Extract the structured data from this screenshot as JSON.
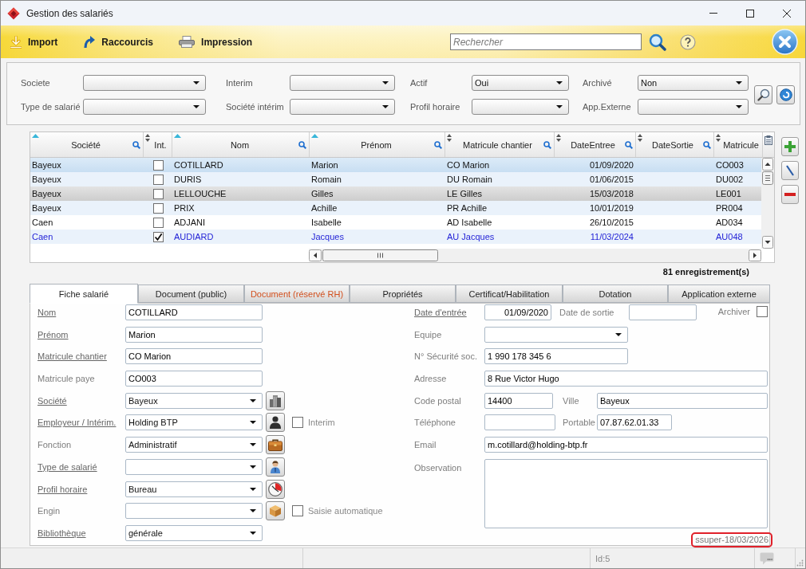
{
  "window": {
    "title": "Gestion des salariés"
  },
  "toolbar": {
    "buttons": [
      {
        "label": "Import"
      },
      {
        "label": "Raccourcis"
      },
      {
        "label": "Impression"
      }
    ],
    "search": {
      "placeholder": "Rechercher"
    }
  },
  "filters": [
    {
      "label": "Societe"
    },
    {
      "label": "Interim"
    },
    {
      "label": "Actif",
      "value": "Oui"
    },
    {
      "label": "Archivé",
      "value": "Non"
    },
    {
      "label": "Type de salarié"
    },
    {
      "label": "Société intérim"
    },
    {
      "label": "Profil horaire"
    },
    {
      "label": "App.Externe"
    }
  ],
  "table": {
    "columns": [
      {
        "label": "Société",
        "sorted": true,
        "searchable": true
      },
      {
        "label": "Int.",
        "sorted": false,
        "searchable": false
      },
      {
        "label": "Nom",
        "sorted": true,
        "searchable": true
      },
      {
        "label": "Prénom",
        "sorted": true,
        "searchable": true
      },
      {
        "label": "Matricule chantier",
        "sorted": false,
        "searchable": true
      },
      {
        "label": "DateEntree",
        "sorted": false,
        "searchable": true
      },
      {
        "label": "DateSortie",
        "sorted": false,
        "searchable": true
      },
      {
        "label": "Matricule",
        "sorted": false
      }
    ],
    "rows": [
      {
        "societe": "Bayeux",
        "interim": false,
        "nom": "COTILLARD",
        "prenom": "Marion",
        "matricule_chantier": "CO Marion",
        "date_entree": "01/09/2020",
        "matricule": "CO003",
        "selected": true,
        "hovered": false
      },
      {
        "societe": "Bayeux",
        "interim": false,
        "nom": "DURIS",
        "prenom": "Romain",
        "matricule_chantier": "DU Romain",
        "date_entree": "01/06/2015",
        "matricule": "DU002",
        "selected": false,
        "hovered": false
      },
      {
        "societe": "Bayeux",
        "interim": false,
        "nom": "LELLOUCHE",
        "prenom": "Gilles",
        "matricule_chantier": "LE Gilles",
        "date_entree": "15/03/2018",
        "matricule": "LE001",
        "selected": false,
        "hovered": true
      },
      {
        "societe": "Bayeux",
        "interim": false,
        "nom": "PRIX",
        "prenom": "Achille",
        "matricule_chantier": "PR Achille",
        "date_entree": "10/01/2019",
        "matricule": "PR004",
        "selected": false,
        "hovered": false
      },
      {
        "societe": "Caen",
        "interim": false,
        "nom": "ADJANI",
        "prenom": "Isabelle",
        "matricule_chantier": "AD Isabelle",
        "date_entree": "26/10/2015",
        "matricule": "AD034",
        "selected": false,
        "hovered": false
      },
      {
        "societe": "Caen",
        "interim": true,
        "nom": "AUDIARD",
        "prenom": "Jacques",
        "matricule_chantier": "AU Jacques",
        "date_entree": "11/03/2024",
        "matricule": "AU048",
        "selected": false,
        "hovered": false
      }
    ],
    "record_count": "81 enregistrement(s)"
  },
  "tabs": [
    {
      "label": "Fiche salarié",
      "selected": true,
      "restricted": false
    },
    {
      "label": "Document (public)",
      "selected": false,
      "restricted": false
    },
    {
      "label": "Document (réservé RH)",
      "selected": false,
      "restricted": true
    },
    {
      "label": "Propriétés",
      "selected": false,
      "restricted": false
    },
    {
      "label": "Certificat/Habilitation",
      "selected": false,
      "restricted": false
    },
    {
      "label": "Dotation",
      "selected": false,
      "restricted": false
    },
    {
      "label": "Application externe",
      "selected": false,
      "restricted": false
    }
  ],
  "form": {
    "left": [
      {
        "kind": "text",
        "label": "Nom",
        "link": true,
        "value": "COTILLARD",
        "button": false
      },
      {
        "kind": "text",
        "label": "Prénom",
        "link": true,
        "value": "Marion",
        "button": false
      },
      {
        "kind": "text",
        "label": "Matricule chantier",
        "link": true,
        "value": "CO Marion",
        "button": false
      },
      {
        "kind": "text",
        "label": "Matricule paye",
        "link": false,
        "value": "CO003",
        "button": false
      },
      {
        "kind": "select",
        "label": "Société",
        "link": true,
        "value": "Bayeux",
        "button": true
      },
      {
        "kind": "select",
        "label": "Employeur / Intérim.",
        "link": true,
        "value": "Holding BTP",
        "button": true,
        "option": {
          "label": "Interim",
          "checked": false
        }
      },
      {
        "kind": "select",
        "label": "Fonction",
        "link": false,
        "value": "Administratif",
        "button": true
      },
      {
        "kind": "select",
        "label": "Type de salarié",
        "link": true,
        "button": true
      },
      {
        "kind": "select",
        "label": "Profil horaire",
        "link": true,
        "value": "Bureau",
        "button": true
      },
      {
        "kind": "select",
        "label": "Engin",
        "link": false,
        "button": true,
        "option": {
          "label": "Saisie automatique",
          "checked": false
        }
      },
      {
        "kind": "select",
        "label": "Bibliothèque",
        "link": true,
        "value": "générale",
        "button": false
      }
    ],
    "right": {
      "entry_date": {
        "label": "Date d'entrée",
        "link": true,
        "value": "01/09/2020"
      },
      "exit_date": {
        "label": "Date de sortie",
        "link": false
      },
      "archive": {
        "label": "Archiver",
        "link": false,
        "checked": false
      },
      "team": {
        "label": "Equipe",
        "link": false
      },
      "social_security": {
        "label": "N° Sécurité soc.",
        "link": false,
        "value": "1 990 178 345 6"
      },
      "address": {
        "label": "Adresse",
        "link": false,
        "value": "8 Rue Victor Hugo"
      },
      "postal_code": {
        "label": "Code postal",
        "link": false,
        "value": "14400"
      },
      "city": {
        "label": "Ville",
        "link": false,
        "value": "Bayeux"
      },
      "phone": {
        "label": "Téléphone",
        "link": false
      },
      "mobile": {
        "label": "Portable",
        "link": false,
        "value": "07.87.62.01.33"
      },
      "email": {
        "label": "Email",
        "link": false,
        "value": "m.cotillard@holding-btp.fr"
      },
      "observation": {
        "label": "Observation",
        "link": false
      }
    },
    "audit_stamp": "ssuper-18/03/2026"
  },
  "status_bar": {
    "id": "Id:5"
  }
}
